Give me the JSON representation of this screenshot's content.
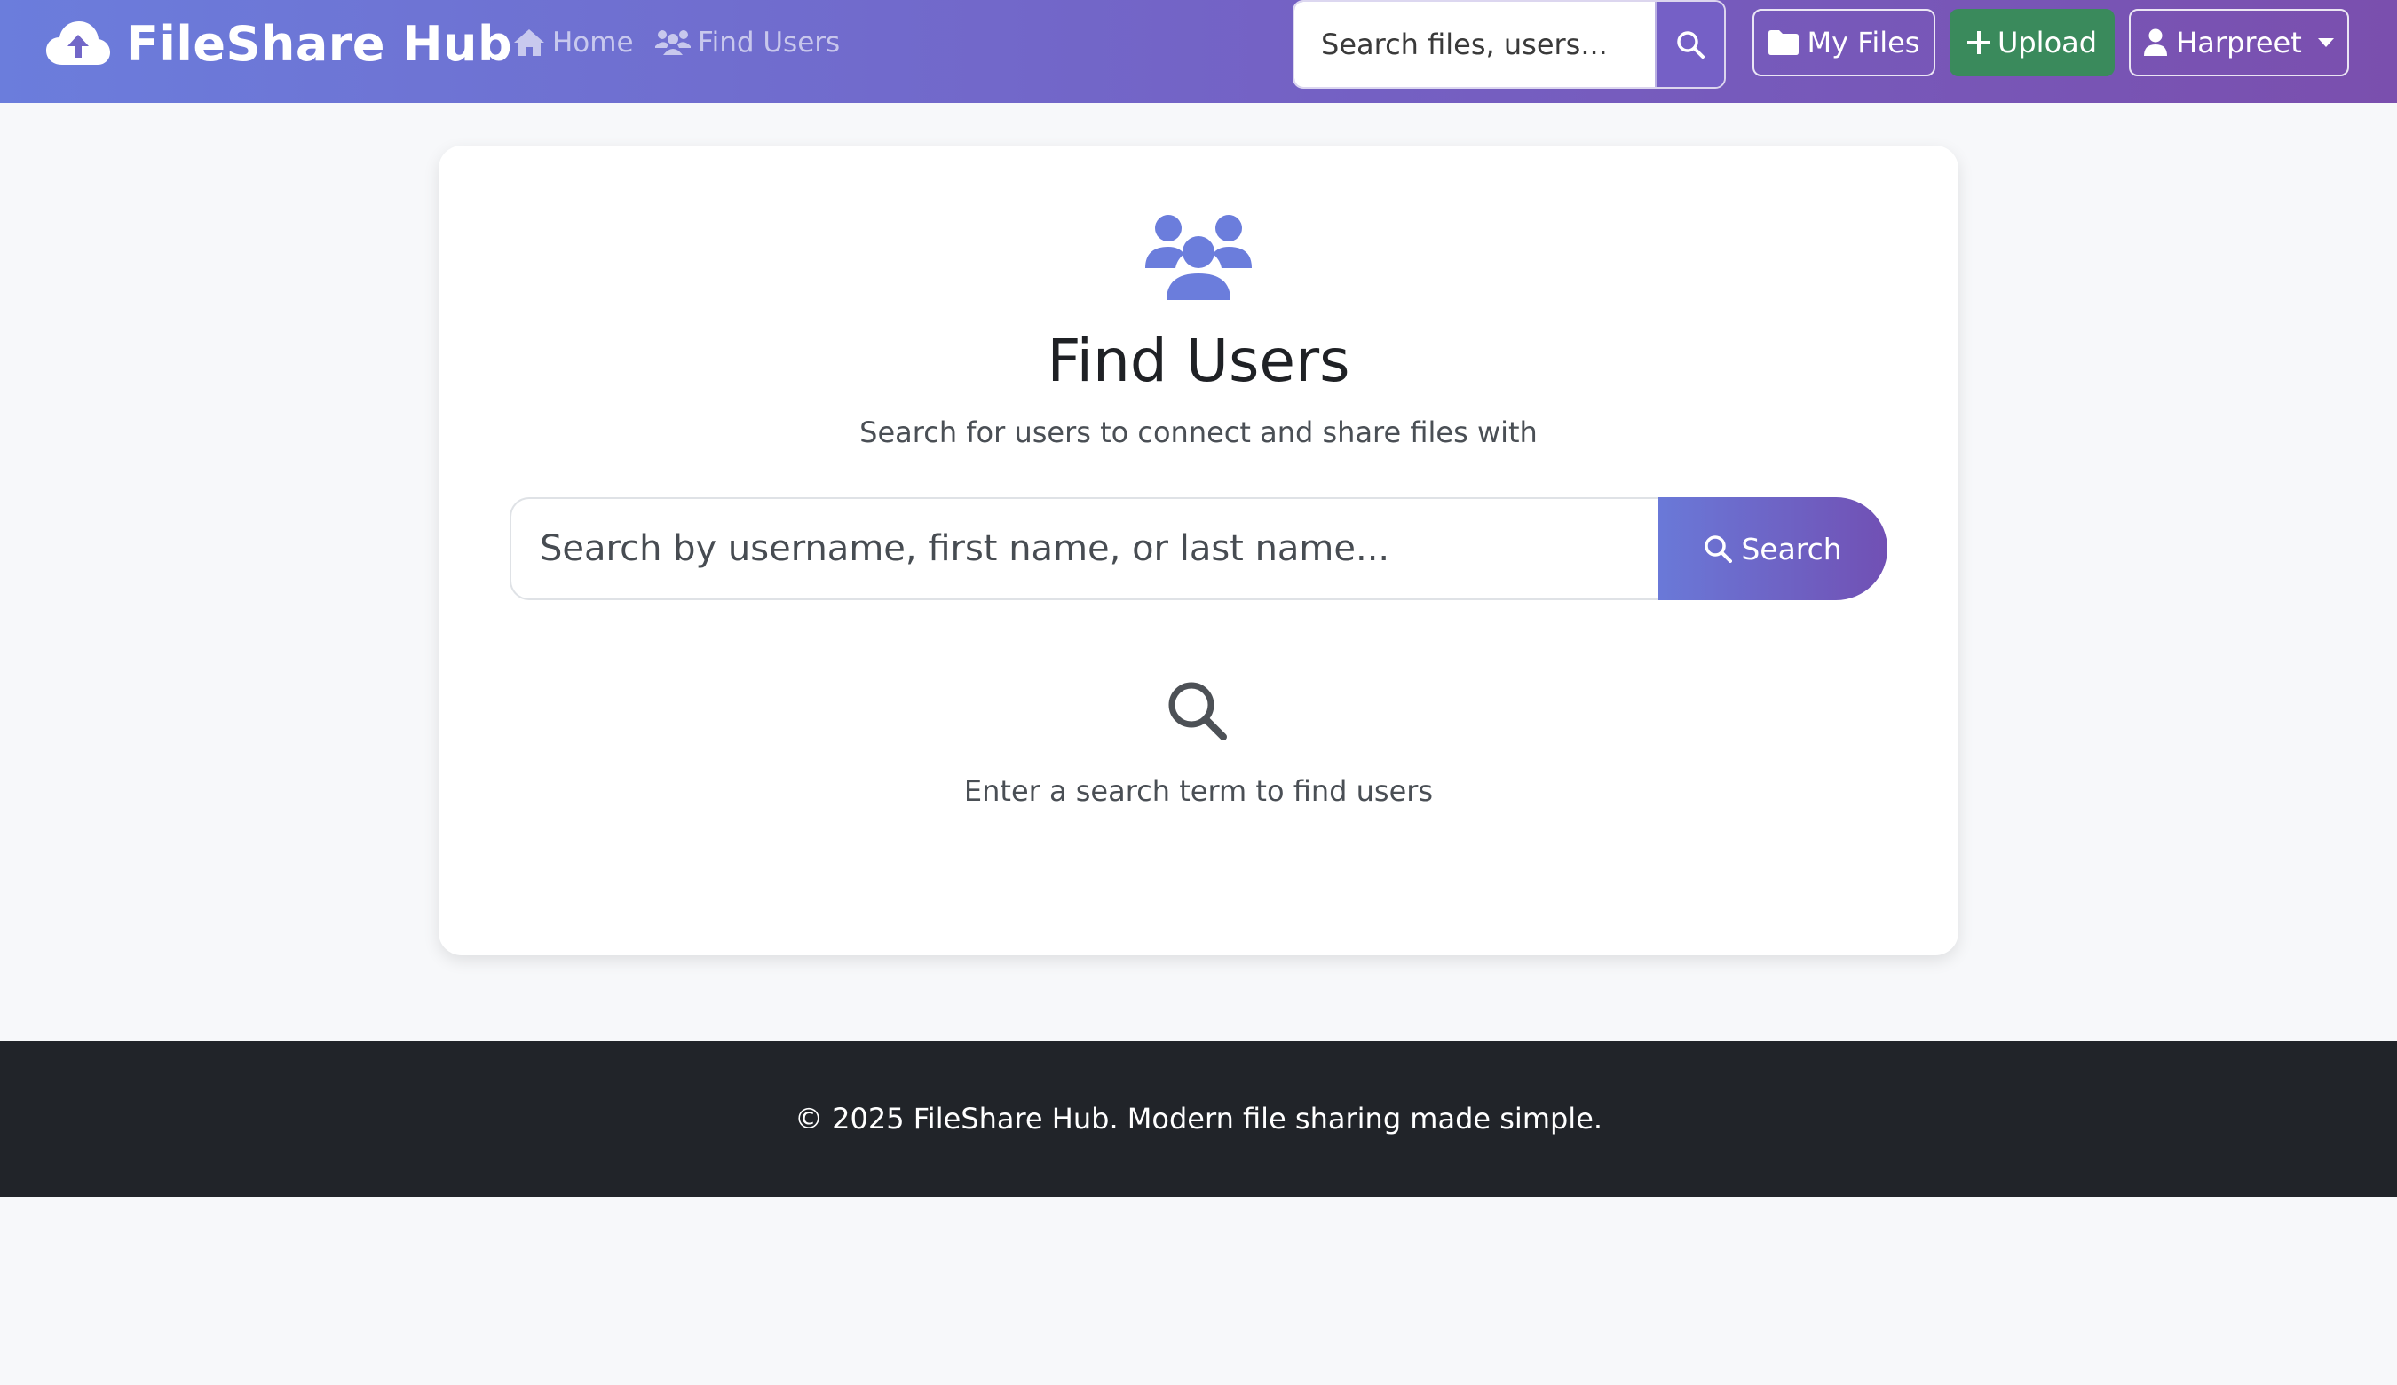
{
  "navbar": {
    "brand": "FileShare Hub",
    "links": [
      {
        "label": "Home",
        "icon": "home-icon"
      },
      {
        "label": "Find Users",
        "icon": "users-icon"
      }
    ],
    "search": {
      "placeholder": "Search files, users..."
    },
    "my_files_label": "My Files",
    "upload_label": "Upload",
    "user_label": "Harpreet"
  },
  "page": {
    "title": "Find Users",
    "subtitle": "Search for users to connect and share files with",
    "search": {
      "placeholder": "Search by username, first name, or last name..."
    },
    "search_button_label": "Search",
    "empty_state": "Enter a search term to find users"
  },
  "footer": {
    "text": "© 2025 FileShare Hub. Modern file sharing made simple."
  },
  "colors": {
    "nav_gradient_start": "#6b7ddc",
    "nav_gradient_end": "#7a4fae",
    "upload_green": "#3a8a5c",
    "accent_icon": "#6b7ddc",
    "footer_bg": "#212429"
  }
}
